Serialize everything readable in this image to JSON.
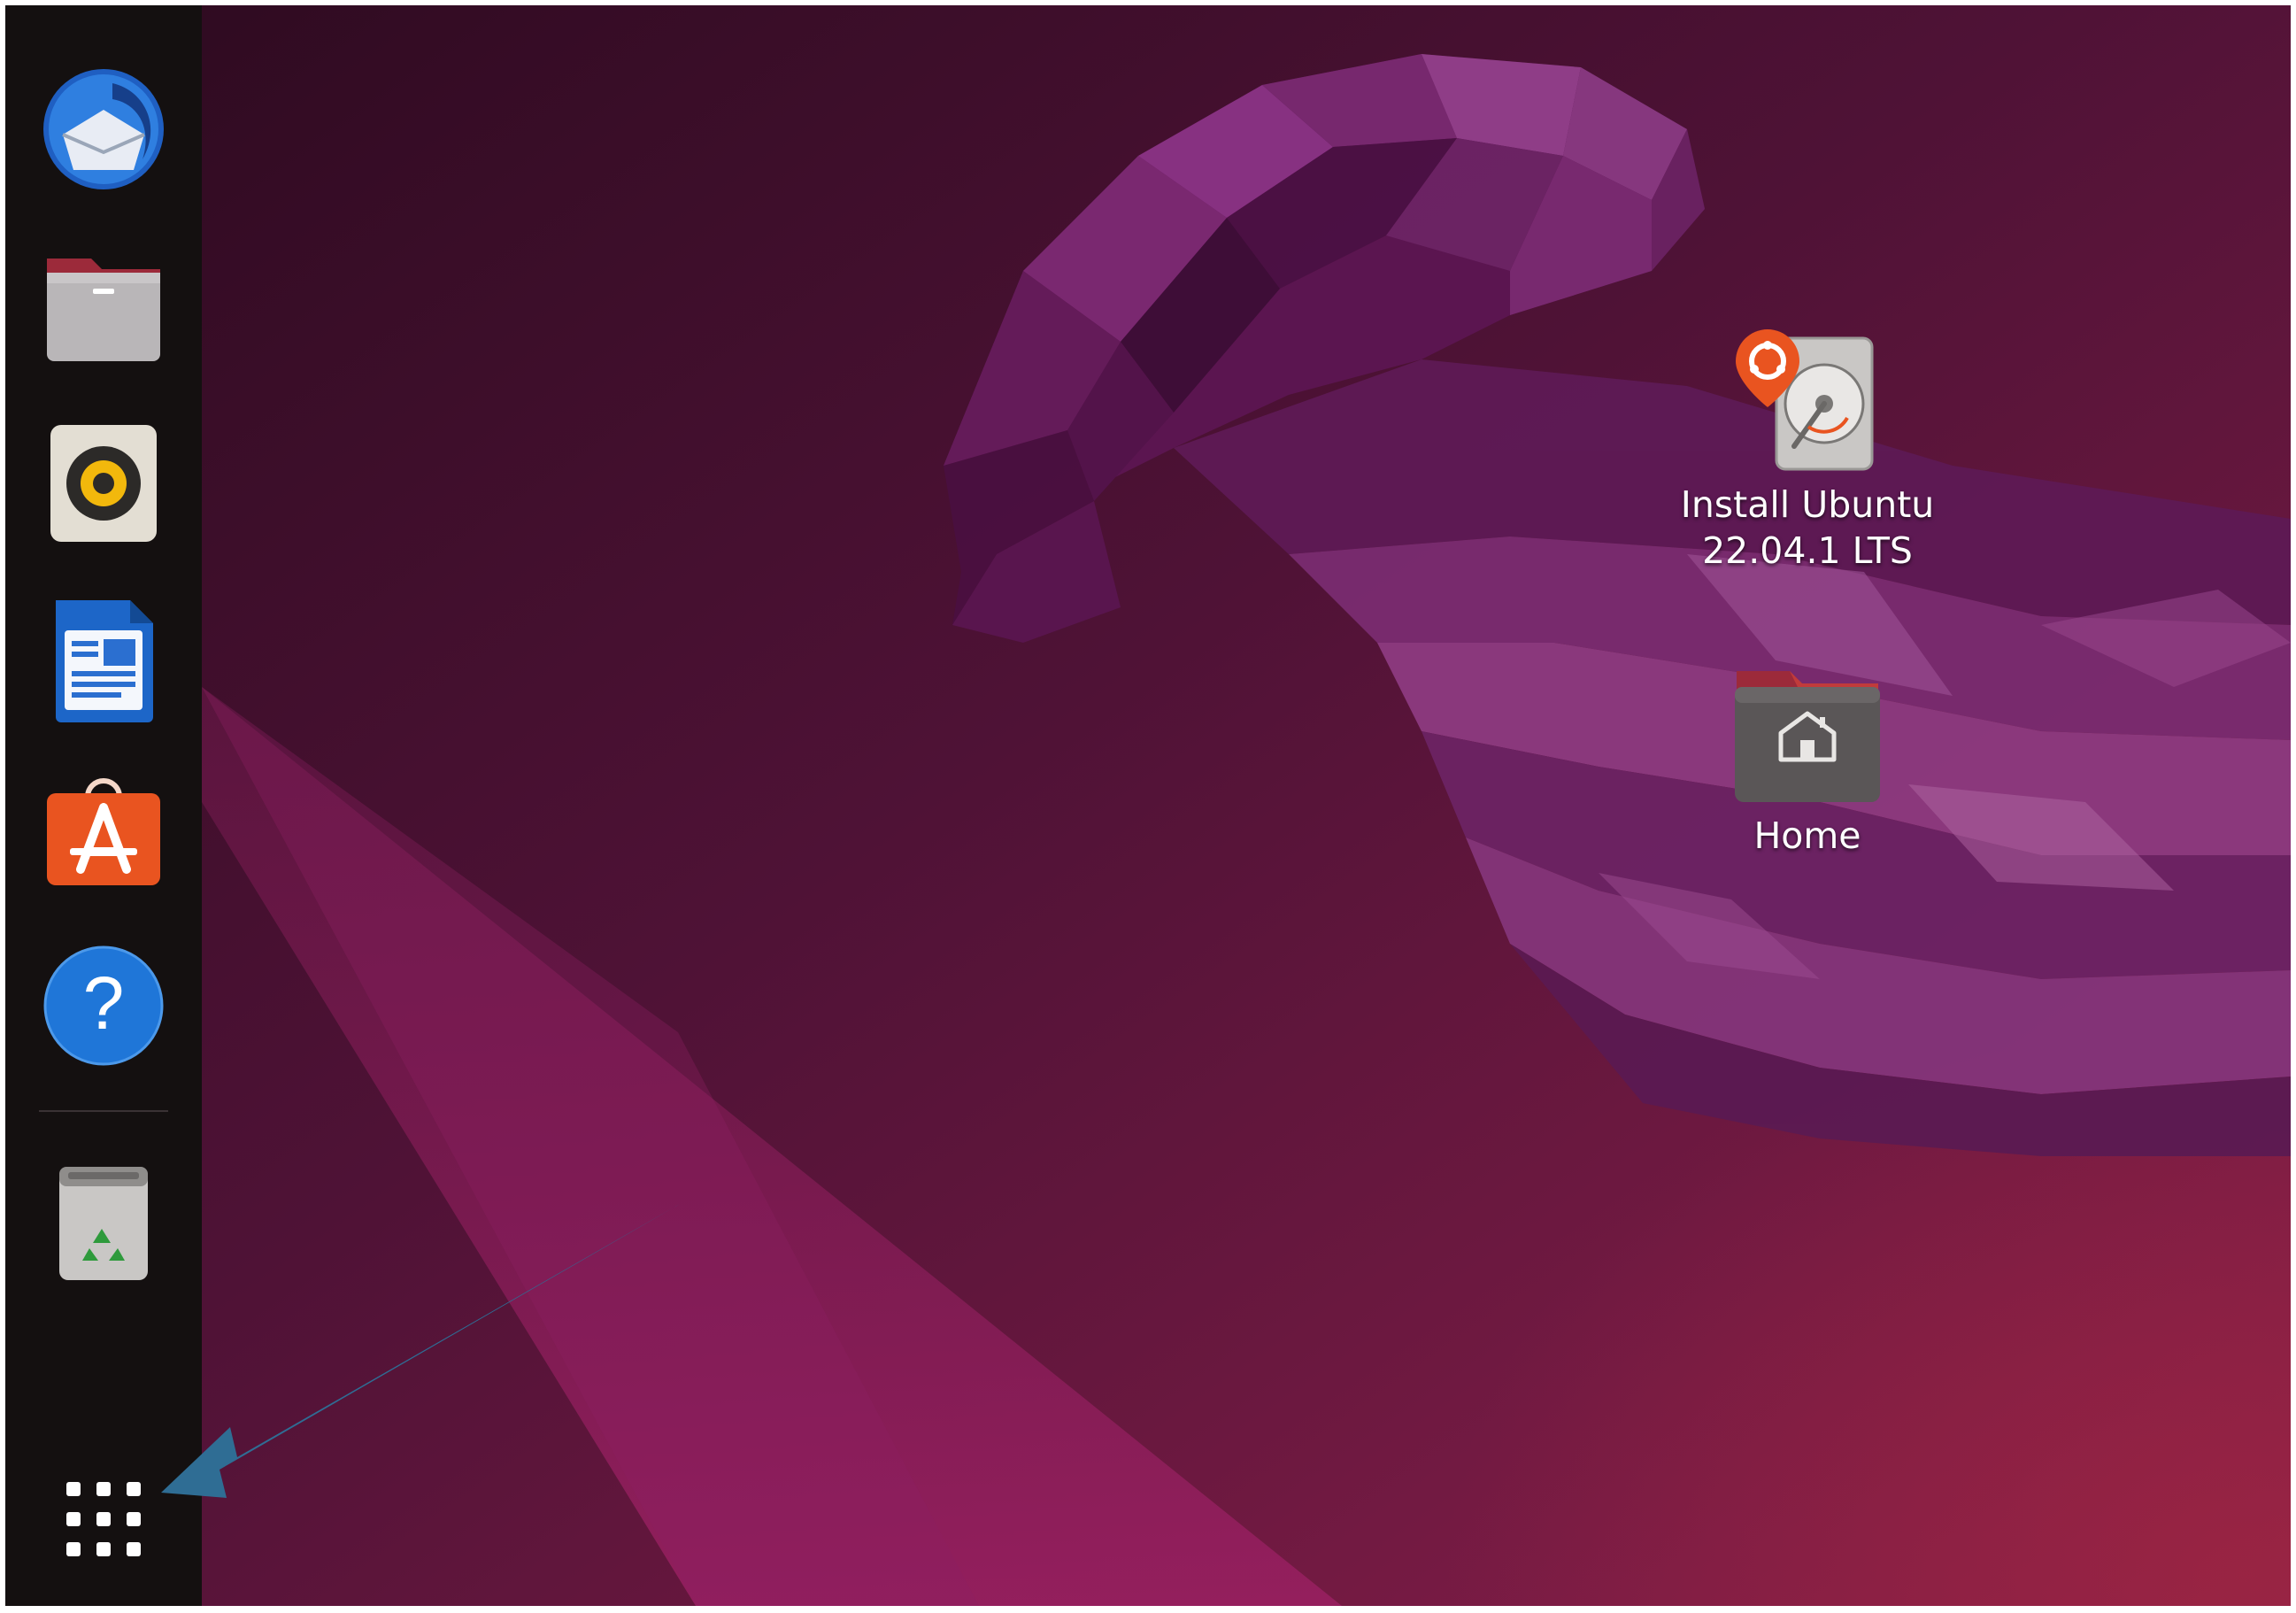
{
  "dock": {
    "items": [
      {
        "name": "Thunderbird Mail",
        "icon": "thunderbird-icon"
      },
      {
        "name": "Files",
        "icon": "files-icon"
      },
      {
        "name": "Rhythmbox",
        "icon": "rhythmbox-icon"
      },
      {
        "name": "LibreOffice Writer",
        "icon": "libreoffice-writer-icon"
      },
      {
        "name": "Ubuntu Software",
        "icon": "ubuntu-software-icon"
      },
      {
        "name": "Help",
        "icon": "help-icon"
      },
      {
        "name": "Trash",
        "icon": "trash-icon"
      }
    ],
    "show_apps_icon": "grid-icon"
  },
  "desktop": {
    "install": {
      "label_line1": "Install Ubuntu",
      "label_line2": "22.04.1 LTS",
      "icon": "install-ubuntu-icon"
    },
    "home": {
      "label": "Home",
      "icon": "home-folder-icon"
    }
  },
  "annotation": {
    "type": "arrow",
    "color": "#2f6d94"
  },
  "colors": {
    "dock_bg": "#141010",
    "wallpaper_dark": "#2c0a1f",
    "wallpaper_mid": "#6a1848",
    "accent_orange": "#e95420"
  }
}
